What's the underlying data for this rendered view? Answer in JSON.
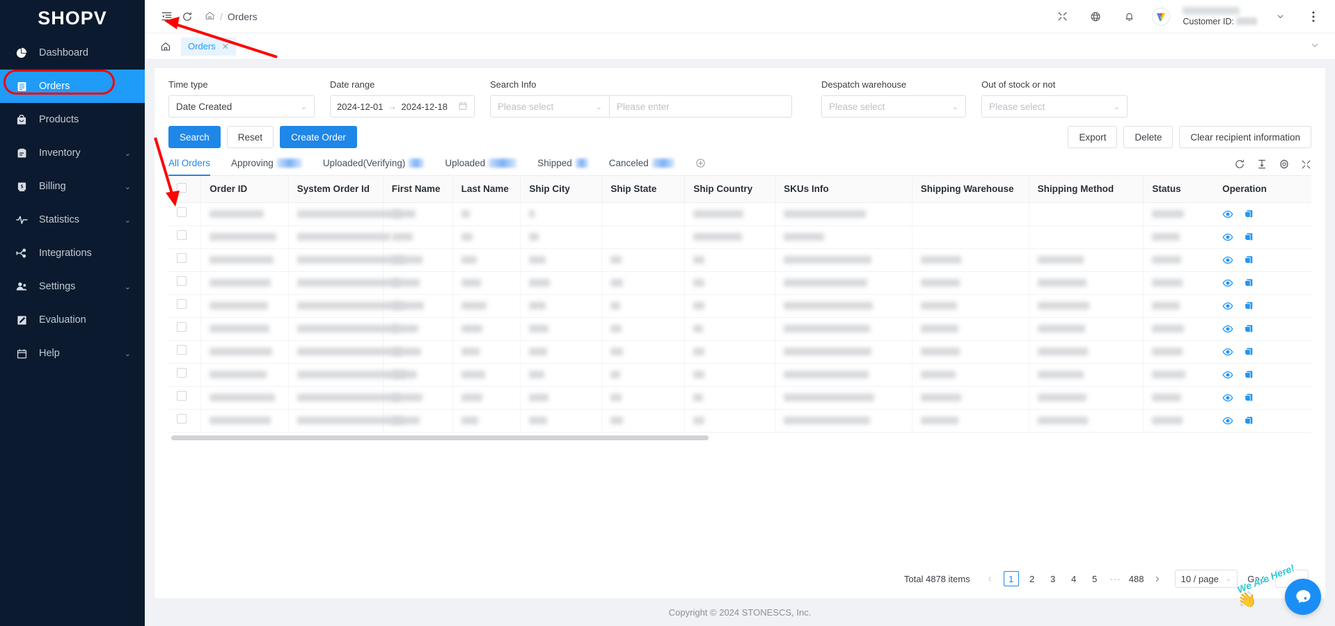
{
  "brand": {
    "name": "SHOPV"
  },
  "sidebar": {
    "items": [
      {
        "label": "Dashboard",
        "icon": "pie-chart-icon",
        "expandable": false,
        "active": false
      },
      {
        "label": "Orders",
        "icon": "list-document-icon",
        "expandable": false,
        "active": true
      },
      {
        "label": "Products",
        "icon": "shopping-bag-icon",
        "expandable": false,
        "active": false
      },
      {
        "label": "Inventory",
        "icon": "box-icon",
        "expandable": true,
        "active": false
      },
      {
        "label": "Billing",
        "icon": "money-bag-icon",
        "expandable": true,
        "active": false
      },
      {
        "label": "Statistics",
        "icon": "pulse-line-icon",
        "expandable": true,
        "active": false
      },
      {
        "label": "Integrations",
        "icon": "plug-connector-icon",
        "expandable": false,
        "active": false
      },
      {
        "label": "Settings",
        "icon": "users-icon",
        "expandable": true,
        "active": false
      },
      {
        "label": "Evaluation",
        "icon": "pencil-square-icon",
        "expandable": false,
        "active": false
      },
      {
        "label": "Help",
        "icon": "calendar-icon",
        "expandable": true,
        "active": false
      }
    ]
  },
  "topbar": {
    "collapse_icon": "collapse-sidebar-icon",
    "refresh_icon": "refresh-icon",
    "breadcrumb": {
      "home_icon": "home-icon",
      "separator": "/",
      "current": "Orders"
    },
    "right_icons": [
      "shrink-icon",
      "globe-language-icon",
      "bell-notification-icon"
    ],
    "avatar_letter": "V",
    "customer_id_label": "Customer ID:",
    "user_caret": "chevron-down-icon",
    "more_icon": "vertical-dots-icon"
  },
  "pagetabs": {
    "home_icon": "home-icon",
    "tabs": [
      {
        "label": "Orders",
        "closable": true,
        "active": true
      }
    ],
    "collapse_icon": "chevron-down-icon"
  },
  "filters": {
    "time_type": {
      "label": "Time type",
      "value": "Date Created"
    },
    "date_range": {
      "label": "Date range",
      "start": "2024-12-01",
      "arrow": "→",
      "end": "2024-12-18",
      "icon": "calendar-icon"
    },
    "search_info": {
      "label": "Search Info",
      "select_placeholder": "Please select",
      "input_placeholder": "Please enter"
    },
    "despatch_warehouse": {
      "label": "Despatch warehouse",
      "placeholder": "Please select"
    },
    "out_of_stock": {
      "label": "Out of stock or not",
      "placeholder": "Please select"
    }
  },
  "actions": {
    "left": [
      {
        "label": "Search",
        "style": "primary"
      },
      {
        "label": "Reset",
        "style": "default"
      },
      {
        "label": "Create Order",
        "style": "primary"
      }
    ],
    "right": [
      {
        "label": "Export"
      },
      {
        "label": "Delete"
      },
      {
        "label": "Clear recipient information"
      }
    ]
  },
  "tabs": {
    "items": [
      {
        "label": "All Orders",
        "active": true,
        "badge_blurred": false,
        "badge_width": 0
      },
      {
        "label": "Approving",
        "active": false,
        "badge_blurred": true,
        "badge_width": 36
      },
      {
        "label": "Uploaded(Verifying)",
        "active": false,
        "badge_blurred": true,
        "badge_width": 22
      },
      {
        "label": "Uploaded",
        "active": false,
        "badge_blurred": true,
        "badge_width": 40
      },
      {
        "label": "Shipped",
        "active": false,
        "badge_blurred": true,
        "badge_width": 18
      },
      {
        "label": "Canceled",
        "active": false,
        "badge_blurred": true,
        "badge_width": 32
      }
    ],
    "add_icon": "add-circle-icon",
    "tools": [
      "refresh-icon",
      "row-density-icon",
      "column-settings-gear-icon",
      "fullscreen-icon"
    ]
  },
  "table": {
    "columns": [
      "Order ID",
      "System Order Id",
      "First Name",
      "Last Name",
      "Ship City",
      "Ship State",
      "Ship Country",
      "SKUs Info",
      "Shipping Warehouse",
      "Shipping Method",
      "Status",
      "Operation"
    ],
    "select_all_checkbox": false,
    "row_count": 10,
    "content_redacted": true,
    "operation_icons": [
      "view-eye-icon",
      "copy-duplicate-icon"
    ]
  },
  "pagination": {
    "total_text": "Total 4878 items",
    "prev_icon": "chevron-left-icon",
    "pages": [
      "1",
      "2",
      "3",
      "4",
      "5"
    ],
    "dots": "···",
    "last_page": "488",
    "next_icon": "chevron-right-icon",
    "current_page": "1",
    "page_size": "10 / page",
    "goto_label": "Go to",
    "goto_value": ""
  },
  "footer": {
    "text": "Copyright © 2024 STONESCS, Inc."
  },
  "chat_widget": {
    "text": "We Are Here!",
    "hand_icon": "waving-hand-icon",
    "bubble_icon": "chat-bubble-icon"
  },
  "colors": {
    "sidebar_bg": "#0b1a2e",
    "accent_blue": "#1f87e8",
    "active_nav": "#1f9bf8",
    "annotation_red": "#ff0000",
    "chat_blue": "#1b8ef5"
  }
}
